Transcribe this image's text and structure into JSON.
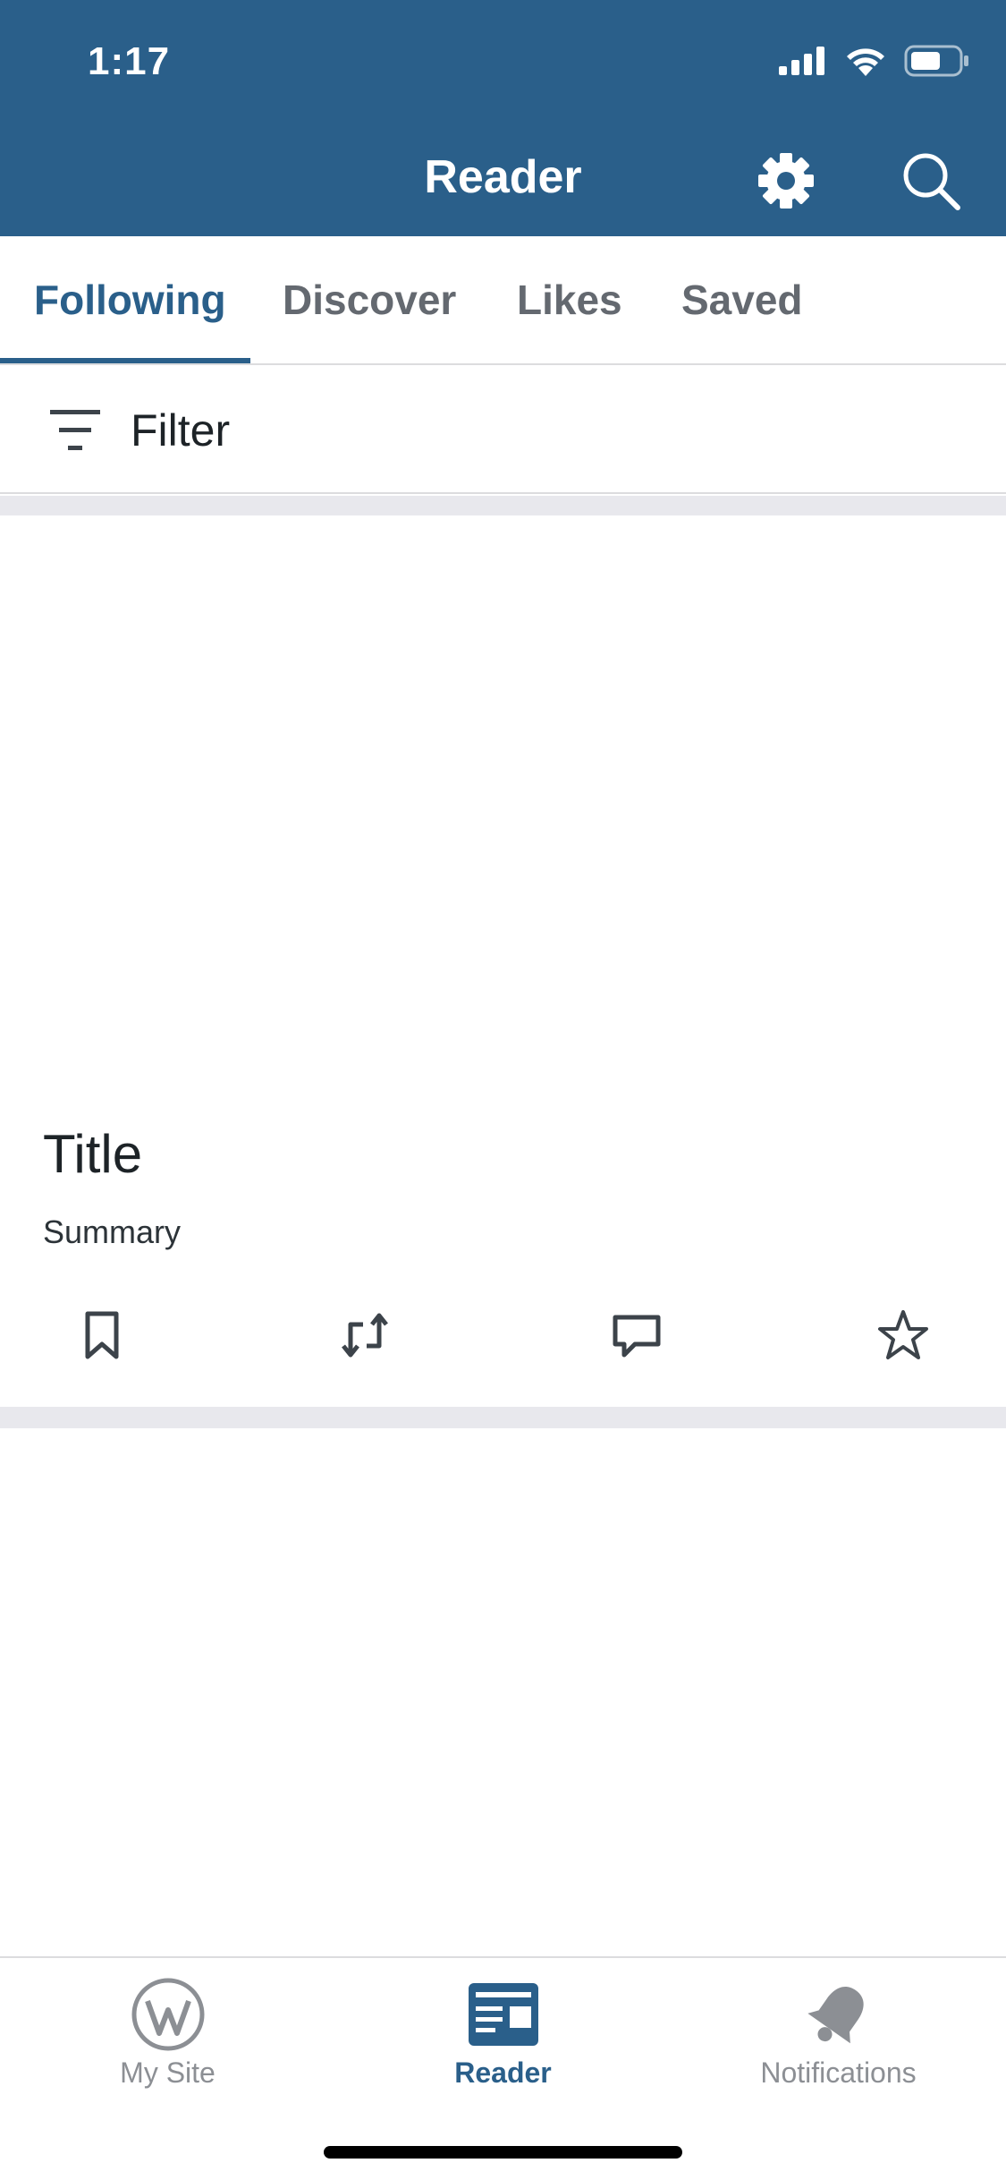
{
  "status_bar": {
    "time": "1:17"
  },
  "nav": {
    "title": "Reader",
    "settings_icon": "gear-icon",
    "search_icon": "search-icon",
    "background": "#2a5f8a"
  },
  "tabs": [
    {
      "label": "Following",
      "active": true
    },
    {
      "label": "Discover",
      "active": false
    },
    {
      "label": "Likes",
      "active": false
    },
    {
      "label": "Saved",
      "active": false
    }
  ],
  "filter": {
    "label": "Filter",
    "icon": "filter-icon"
  },
  "post": {
    "title": "Title",
    "summary": "Summary",
    "actions": [
      "bookmark-icon",
      "reblog-icon",
      "comment-icon",
      "star-icon"
    ]
  },
  "tab_bar": {
    "items": [
      {
        "label": "My Site",
        "icon": "wordpress-icon",
        "active": false
      },
      {
        "label": "Reader",
        "icon": "reader-icon",
        "active": true
      },
      {
        "label": "Notifications",
        "icon": "bell-icon",
        "active": false
      }
    ]
  }
}
